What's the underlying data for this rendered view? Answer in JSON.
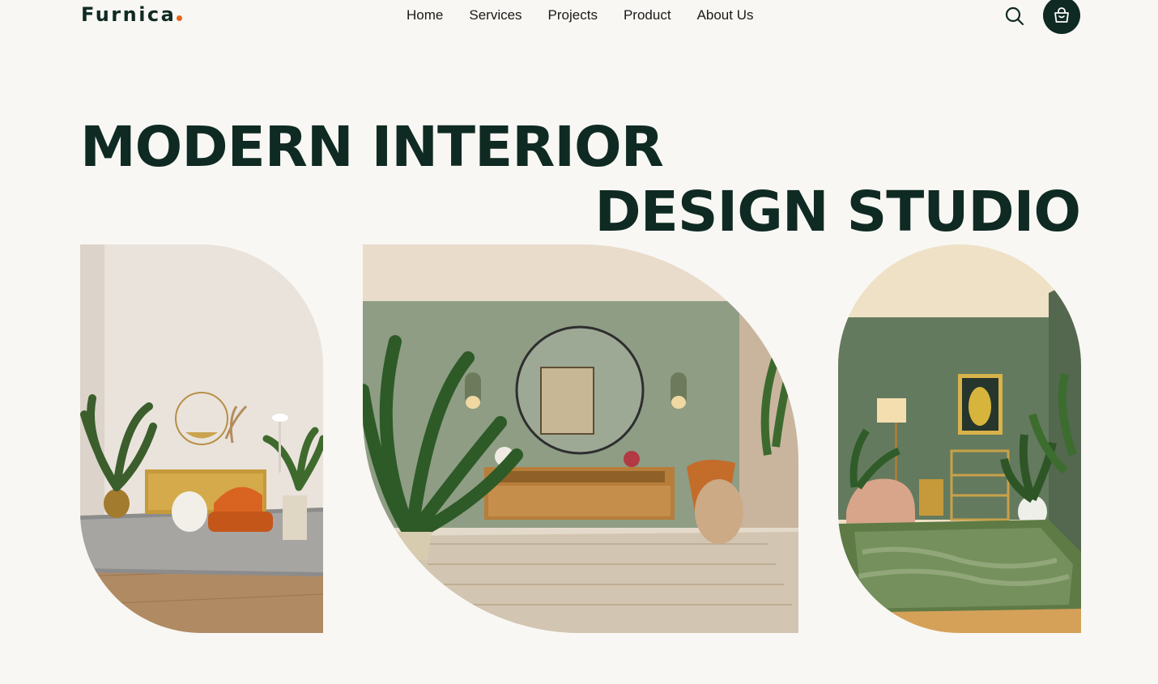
{
  "header": {
    "logo": "Furnica",
    "nav": [
      "Home",
      "Services",
      "Projects",
      "Product",
      "About Us"
    ],
    "search_icon": "search-icon",
    "cart_icon": "shopping-bag-icon"
  },
  "hero": {
    "line1": "MODERN INTERIOR",
    "line2": "DESIGN STUDIO"
  },
  "colors": {
    "primary": "#0f2a22",
    "accent": "#e8641b",
    "background": "#f8f7f4"
  }
}
